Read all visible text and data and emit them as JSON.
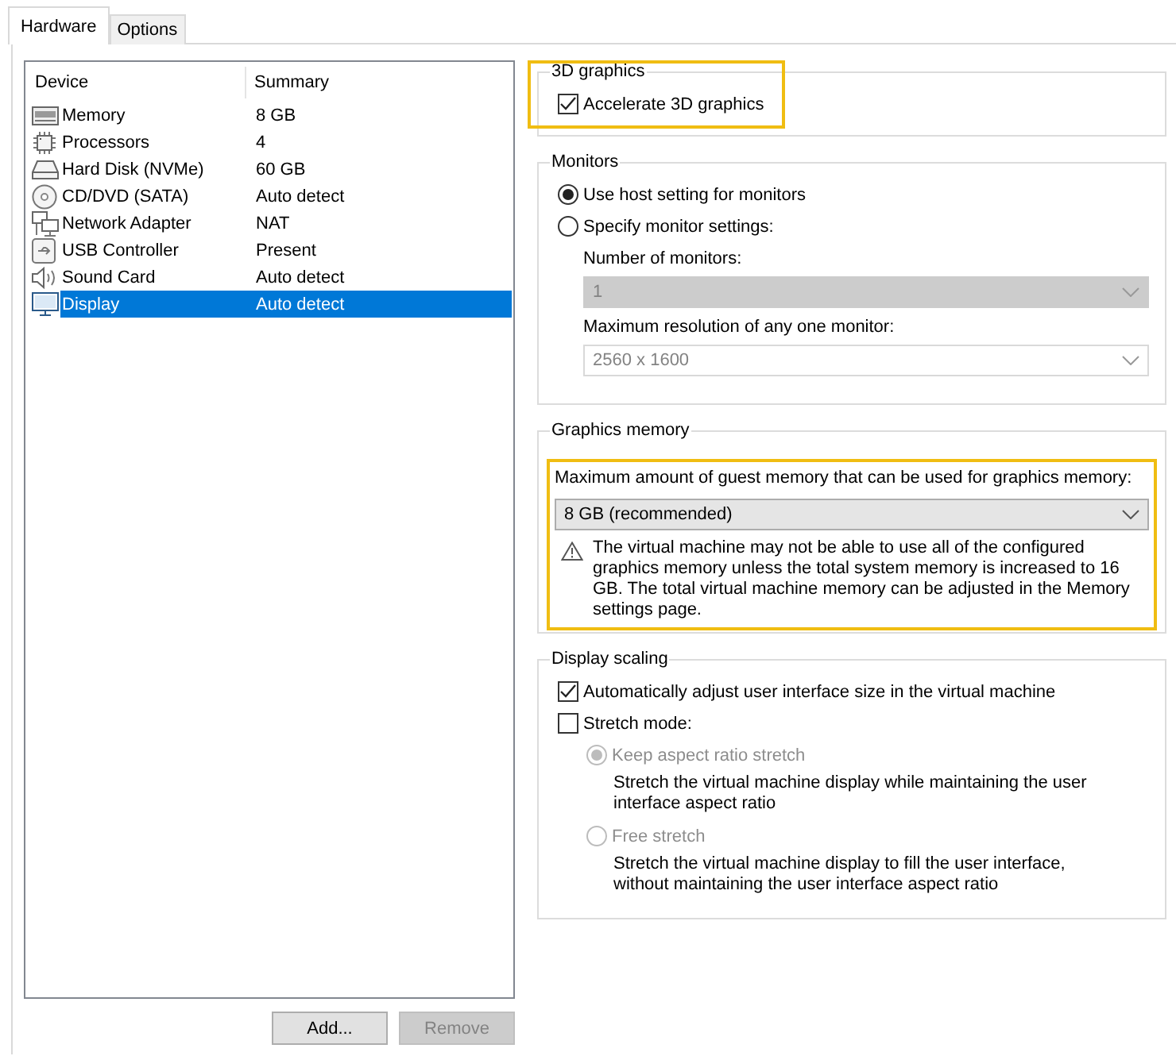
{
  "tabs": [
    {
      "label": "Hardware",
      "selected": true
    },
    {
      "label": "Options",
      "selected": false
    }
  ],
  "device_list": {
    "columns": [
      "Device",
      "Summary"
    ],
    "rows": [
      {
        "kind": "memory",
        "device": "Memory",
        "summary": "8 GB",
        "selected": false
      },
      {
        "kind": "processor",
        "device": "Processors",
        "summary": "4",
        "selected": false
      },
      {
        "kind": "disk",
        "device": "Hard Disk (NVMe)",
        "summary": "60 GB",
        "selected": false
      },
      {
        "kind": "cd",
        "device": "CD/DVD (SATA)",
        "summary": "Auto detect",
        "selected": false
      },
      {
        "kind": "network",
        "device": "Network Adapter",
        "summary": "NAT",
        "selected": false
      },
      {
        "kind": "usb",
        "device": "USB Controller",
        "summary": "Present",
        "selected": false
      },
      {
        "kind": "sound",
        "device": "Sound Card",
        "summary": "Auto detect",
        "selected": false
      },
      {
        "kind": "display",
        "device": "Display",
        "summary": "Auto detect",
        "selected": true
      }
    ]
  },
  "buttons": [
    {
      "label": "Add...",
      "disabled": false
    },
    {
      "label": "Remove",
      "disabled": true
    }
  ],
  "graphics_3d": {
    "title": "3D graphics",
    "highlighted": true,
    "checkbox": {
      "label": "Accelerate 3D graphics",
      "checked": true
    }
  },
  "monitors": {
    "title": "Monitors",
    "options": [
      {
        "label": "Use host setting for monitors",
        "selected": true
      },
      {
        "label": "Specify monitor settings:",
        "selected": false
      }
    ],
    "fields": [
      {
        "kind": "select",
        "label": "Number of monitors:",
        "value": "1",
        "disabled": true
      },
      {
        "kind": "combo",
        "label": "Maximum resolution of any one monitor:",
        "value": "2560 x 1600",
        "disabled": true
      }
    ]
  },
  "graphics_memory": {
    "title": "Graphics memory",
    "highlighted": true,
    "label": "Maximum amount of guest memory that can be used for graphics memory:",
    "value": "8 GB (recommended)",
    "warning": "The virtual machine may not be able to use all of the configured graphics memory unless the total system memory is increased to 16 GB. The total virtual machine memory can be adjusted in the Memory settings page."
  },
  "display_scaling": {
    "title": "Display scaling",
    "checkboxes": [
      {
        "label": "Automatically adjust user interface size in the virtual machine",
        "checked": true
      },
      {
        "label": "Stretch mode:",
        "checked": false
      }
    ],
    "stretch_options": [
      {
        "label": "Keep aspect ratio stretch",
        "selected": true,
        "disabled": true,
        "description": "Stretch the virtual machine display while maintaining the user interface aspect ratio"
      },
      {
        "label": "Free stretch",
        "selected": false,
        "disabled": true,
        "description": "Stretch the virtual machine display to fill the user interface, without maintaining the user interface aspect ratio"
      }
    ]
  }
}
